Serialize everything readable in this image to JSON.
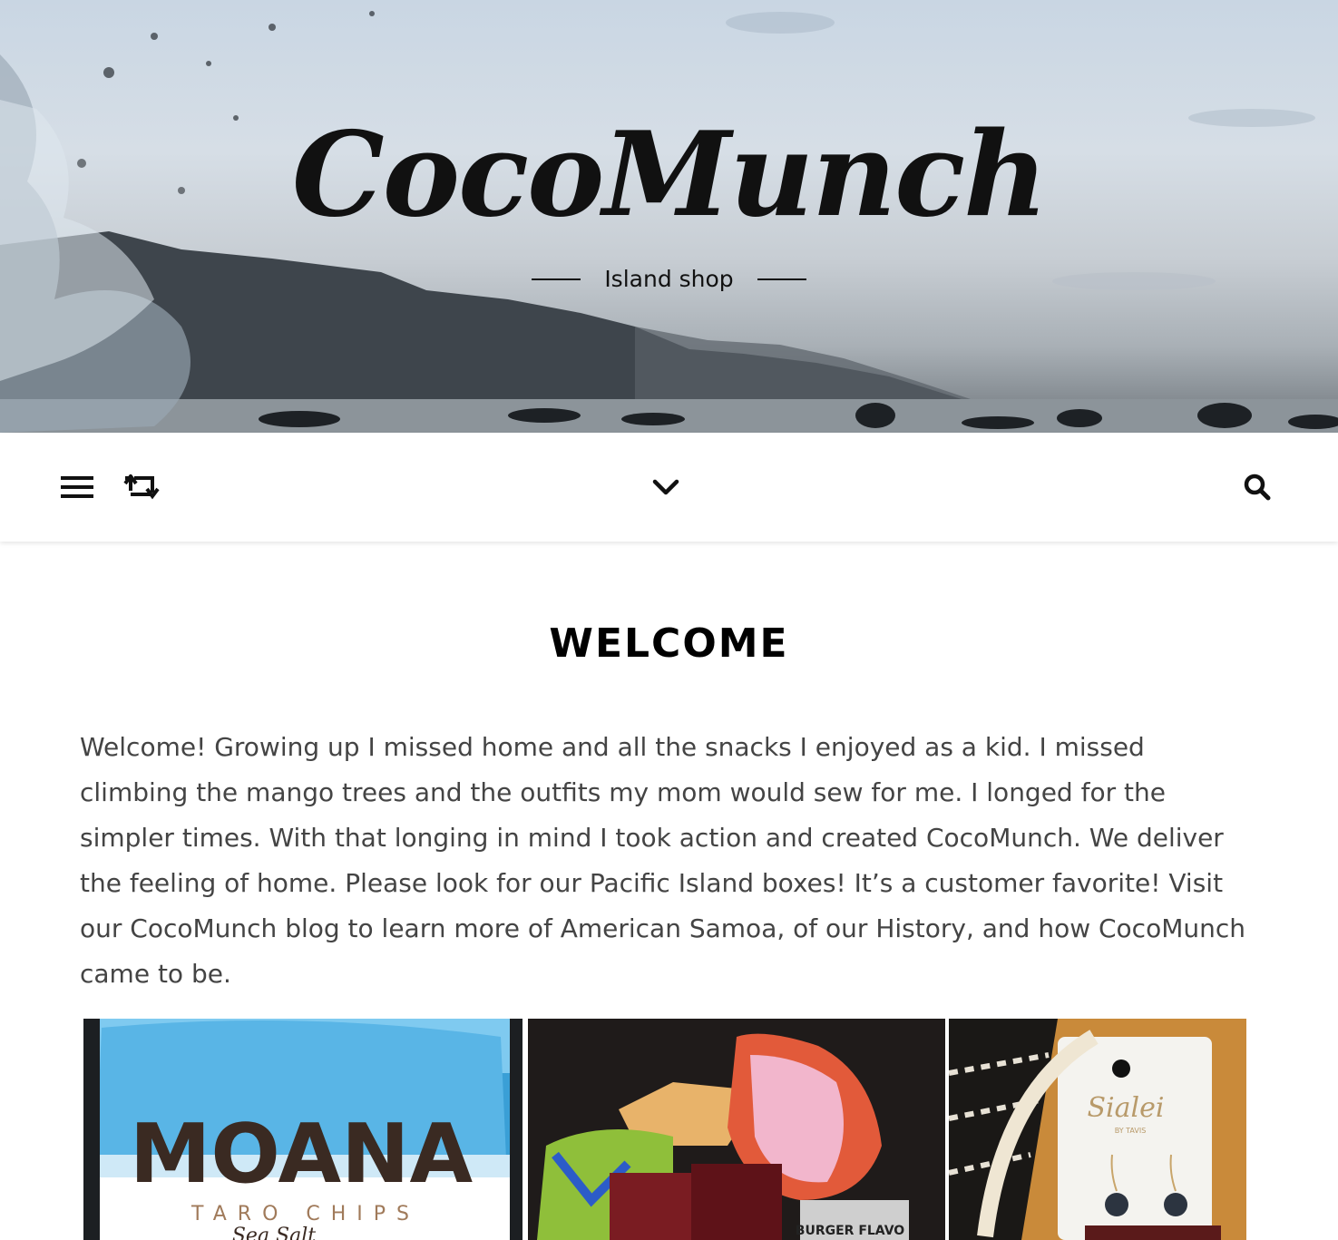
{
  "header": {
    "site_title": "CocoMunch",
    "tagline": "Island shop"
  },
  "nav": {
    "menu_icon": "hamburger-icon",
    "random_icon": "shuffle-icon",
    "expand_icon": "chevron-down-icon",
    "search_icon": "search-icon"
  },
  "main": {
    "title": "WELCOME",
    "intro": "Welcome! Growing up I missed home and all the snacks I enjoyed as a kid. I missed climbing the mango trees and the outfits my mom would sew for me. I longed for the simpler times. With that longing in mind I took action and created CocoMunch. We deliver the feeling of home.  Please look for our Pacific Island boxes! It’s a customer favorite! Visit our CocoMunch blog to learn more of American Samoa, of our History, and how CocoMunch came to be."
  },
  "gallery": {
    "moana": {
      "brand": "MOANA",
      "product": "TARO CHIPS",
      "flavor": "Sea Salt"
    },
    "box": {
      "label": "BURGER FLAVO"
    },
    "jewelry": {
      "brand": "Sialei",
      "sub": "BY TAVIS"
    }
  }
}
